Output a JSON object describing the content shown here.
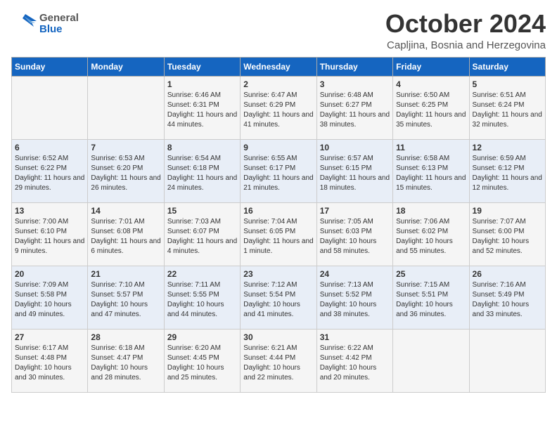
{
  "logo": {
    "general": "General",
    "blue": "Blue"
  },
  "title": "October 2024",
  "location": "Capljina, Bosnia and Herzegovina",
  "days_of_week": [
    "Sunday",
    "Monday",
    "Tuesday",
    "Wednesday",
    "Thursday",
    "Friday",
    "Saturday"
  ],
  "weeks": [
    [
      {
        "day": "",
        "content": ""
      },
      {
        "day": "",
        "content": ""
      },
      {
        "day": "1",
        "content": "Sunrise: 6:46 AM\nSunset: 6:31 PM\nDaylight: 11 hours and 44 minutes."
      },
      {
        "day": "2",
        "content": "Sunrise: 6:47 AM\nSunset: 6:29 PM\nDaylight: 11 hours and 41 minutes."
      },
      {
        "day": "3",
        "content": "Sunrise: 6:48 AM\nSunset: 6:27 PM\nDaylight: 11 hours and 38 minutes."
      },
      {
        "day": "4",
        "content": "Sunrise: 6:50 AM\nSunset: 6:25 PM\nDaylight: 11 hours and 35 minutes."
      },
      {
        "day": "5",
        "content": "Sunrise: 6:51 AM\nSunset: 6:24 PM\nDaylight: 11 hours and 32 minutes."
      }
    ],
    [
      {
        "day": "6",
        "content": "Sunrise: 6:52 AM\nSunset: 6:22 PM\nDaylight: 11 hours and 29 minutes."
      },
      {
        "day": "7",
        "content": "Sunrise: 6:53 AM\nSunset: 6:20 PM\nDaylight: 11 hours and 26 minutes."
      },
      {
        "day": "8",
        "content": "Sunrise: 6:54 AM\nSunset: 6:18 PM\nDaylight: 11 hours and 24 minutes."
      },
      {
        "day": "9",
        "content": "Sunrise: 6:55 AM\nSunset: 6:17 PM\nDaylight: 11 hours and 21 minutes."
      },
      {
        "day": "10",
        "content": "Sunrise: 6:57 AM\nSunset: 6:15 PM\nDaylight: 11 hours and 18 minutes."
      },
      {
        "day": "11",
        "content": "Sunrise: 6:58 AM\nSunset: 6:13 PM\nDaylight: 11 hours and 15 minutes."
      },
      {
        "day": "12",
        "content": "Sunrise: 6:59 AM\nSunset: 6:12 PM\nDaylight: 11 hours and 12 minutes."
      }
    ],
    [
      {
        "day": "13",
        "content": "Sunrise: 7:00 AM\nSunset: 6:10 PM\nDaylight: 11 hours and 9 minutes."
      },
      {
        "day": "14",
        "content": "Sunrise: 7:01 AM\nSunset: 6:08 PM\nDaylight: 11 hours and 6 minutes."
      },
      {
        "day": "15",
        "content": "Sunrise: 7:03 AM\nSunset: 6:07 PM\nDaylight: 11 hours and 4 minutes."
      },
      {
        "day": "16",
        "content": "Sunrise: 7:04 AM\nSunset: 6:05 PM\nDaylight: 11 hours and 1 minute."
      },
      {
        "day": "17",
        "content": "Sunrise: 7:05 AM\nSunset: 6:03 PM\nDaylight: 10 hours and 58 minutes."
      },
      {
        "day": "18",
        "content": "Sunrise: 7:06 AM\nSunset: 6:02 PM\nDaylight: 10 hours and 55 minutes."
      },
      {
        "day": "19",
        "content": "Sunrise: 7:07 AM\nSunset: 6:00 PM\nDaylight: 10 hours and 52 minutes."
      }
    ],
    [
      {
        "day": "20",
        "content": "Sunrise: 7:09 AM\nSunset: 5:58 PM\nDaylight: 10 hours and 49 minutes."
      },
      {
        "day": "21",
        "content": "Sunrise: 7:10 AM\nSunset: 5:57 PM\nDaylight: 10 hours and 47 minutes."
      },
      {
        "day": "22",
        "content": "Sunrise: 7:11 AM\nSunset: 5:55 PM\nDaylight: 10 hours and 44 minutes."
      },
      {
        "day": "23",
        "content": "Sunrise: 7:12 AM\nSunset: 5:54 PM\nDaylight: 10 hours and 41 minutes."
      },
      {
        "day": "24",
        "content": "Sunrise: 7:13 AM\nSunset: 5:52 PM\nDaylight: 10 hours and 38 minutes."
      },
      {
        "day": "25",
        "content": "Sunrise: 7:15 AM\nSunset: 5:51 PM\nDaylight: 10 hours and 36 minutes."
      },
      {
        "day": "26",
        "content": "Sunrise: 7:16 AM\nSunset: 5:49 PM\nDaylight: 10 hours and 33 minutes."
      }
    ],
    [
      {
        "day": "27",
        "content": "Sunrise: 6:17 AM\nSunset: 4:48 PM\nDaylight: 10 hours and 30 minutes."
      },
      {
        "day": "28",
        "content": "Sunrise: 6:18 AM\nSunset: 4:47 PM\nDaylight: 10 hours and 28 minutes."
      },
      {
        "day": "29",
        "content": "Sunrise: 6:20 AM\nSunset: 4:45 PM\nDaylight: 10 hours and 25 minutes."
      },
      {
        "day": "30",
        "content": "Sunrise: 6:21 AM\nSunset: 4:44 PM\nDaylight: 10 hours and 22 minutes."
      },
      {
        "day": "31",
        "content": "Sunrise: 6:22 AM\nSunset: 4:42 PM\nDaylight: 10 hours and 20 minutes."
      },
      {
        "day": "",
        "content": ""
      },
      {
        "day": "",
        "content": ""
      }
    ]
  ]
}
